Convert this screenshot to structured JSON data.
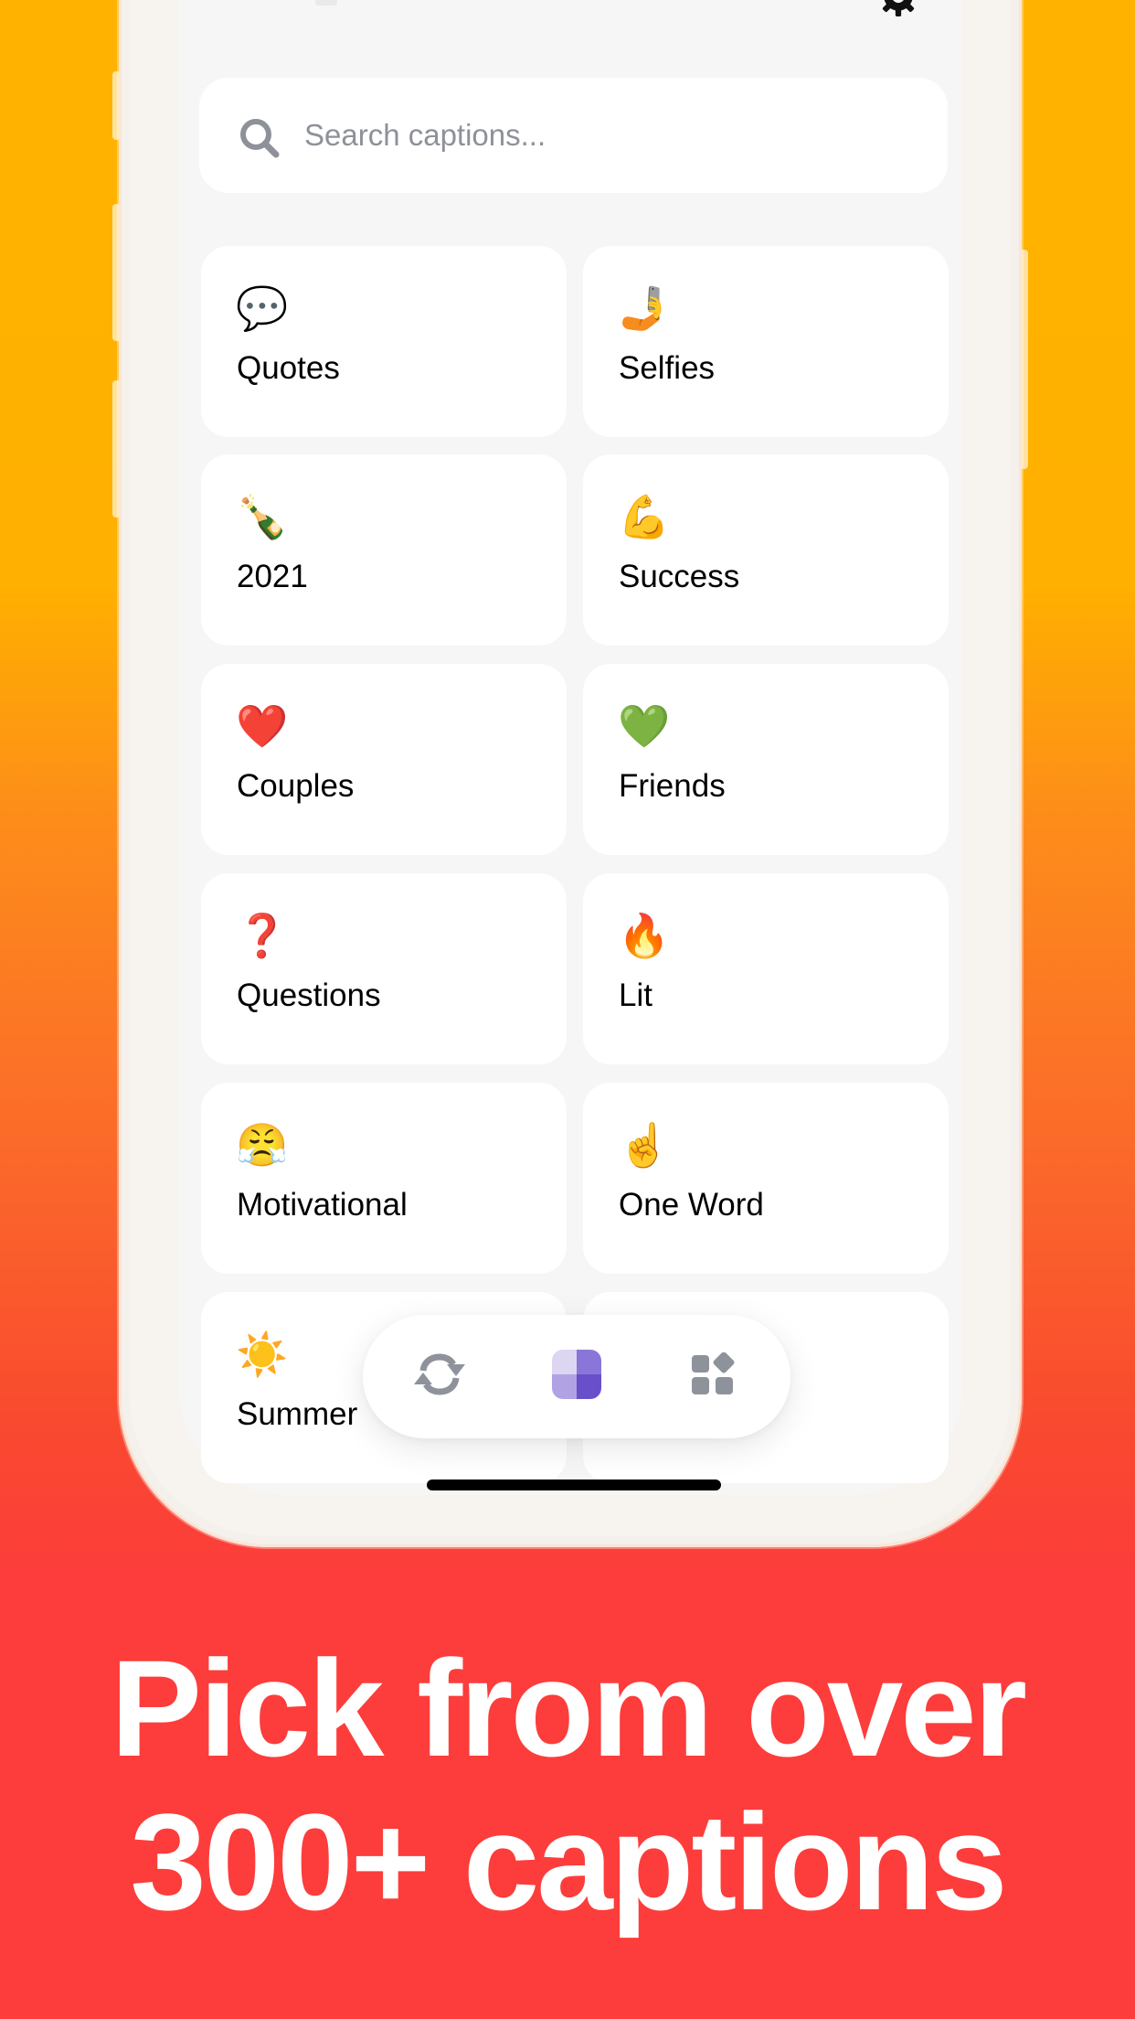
{
  "app": {
    "search": {
      "placeholder": "Search captions...",
      "icon": "search-icon"
    },
    "header": {
      "settings_icon": "gear-icon"
    },
    "categories": [
      {
        "emoji": "💬",
        "label": "Quotes"
      },
      {
        "emoji": "🤳",
        "label": "Selfies"
      },
      {
        "emoji": "🍾",
        "label": "2021"
      },
      {
        "emoji": "💪",
        "label": "Success"
      },
      {
        "emoji": "❤️",
        "label": "Couples"
      },
      {
        "emoji": "💚",
        "label": "Friends"
      },
      {
        "emoji": "❓",
        "label": "Questions"
      },
      {
        "emoji": "🔥",
        "label": "Lit"
      },
      {
        "emoji": "😤",
        "label": "Motivational"
      },
      {
        "emoji": "☝️",
        "label": "One Word"
      },
      {
        "emoji": "☀️",
        "label": "Summer"
      },
      {
        "emoji": "",
        "label": ""
      }
    ],
    "tab_bar": {
      "items": [
        {
          "name": "generate",
          "icon": "refresh-icon",
          "active": false
        },
        {
          "name": "categories",
          "icon": "quadrant-icon",
          "active": true
        },
        {
          "name": "more",
          "icon": "apps-grid-icon",
          "active": false
        }
      ],
      "active_colors": {
        "top_left": "#DCD6F2",
        "top_right": "#8A76D8",
        "bottom_left": "#B1A3E3",
        "bottom_right": "#6A4FCB"
      },
      "inactive_color": "#8E939B"
    }
  },
  "marketing": {
    "headline_line1": "Pick from over",
    "headline_line2": "300+ captions"
  },
  "colors": {
    "background_top": "#FFB300",
    "background_bottom": "#FC3D3B",
    "screen_bg": "#F6F6F6",
    "card_bg": "#FFFFFF"
  }
}
